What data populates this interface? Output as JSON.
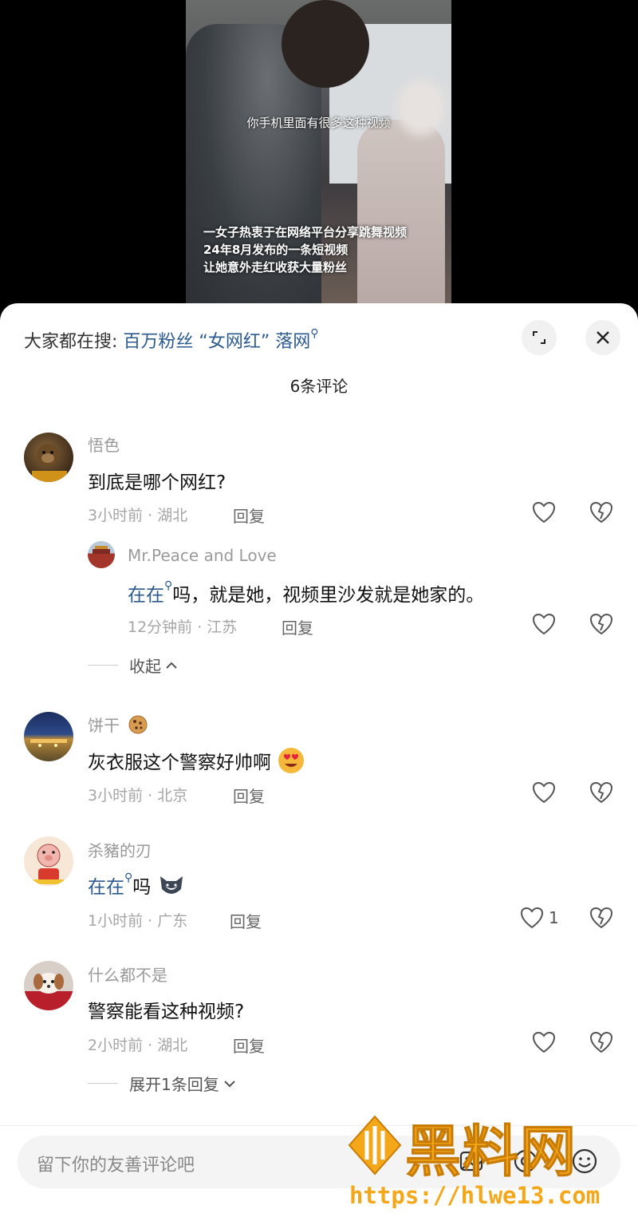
{
  "video": {
    "subtitle": "你手机里面有很多这种视频",
    "caption_lines": [
      "一女子热衷于在网络平台分享跳舞视频",
      "24年8月发布的一条短视频",
      "让她意外走红收获大量粉丝"
    ]
  },
  "header": {
    "search_prefix": "大家都在搜:",
    "search_query": "百万粉丝 “女网红” 落网",
    "comment_count": "6条评论"
  },
  "comments": [
    {
      "name": "悟色",
      "text": "到底是哪个网红?",
      "meta": "3小时前 · 湖北",
      "reply": "回复",
      "replies": [
        {
          "name": "Mr.Peace and Love",
          "link": "在在",
          "text": "吗，就是她，视频里沙发就是她家的。",
          "meta": "12分钟前 · 江苏",
          "reply": "回复"
        }
      ],
      "collapse": "收起"
    },
    {
      "name": "饼干",
      "text": "灰衣服这个警察好帅啊",
      "meta": "3小时前 · 北京",
      "reply": "回复"
    },
    {
      "name": "杀豬的刃",
      "link": "在在",
      "text": "吗",
      "meta": "1小时前 · 广东",
      "reply": "回复",
      "like_count": "1"
    },
    {
      "name": "什么都不是",
      "text": "警察能看这种视频?",
      "meta": "2小时前 · 湖北",
      "reply": "回复",
      "expand": "展开1条回复"
    }
  ],
  "input": {
    "placeholder": "留下你的友善评论吧"
  },
  "watermark": {
    "title": "黑料网",
    "url": "https://hlwe13.com"
  },
  "colors": {
    "link": "#2b5a8f",
    "watermark": "#f5a71a"
  }
}
